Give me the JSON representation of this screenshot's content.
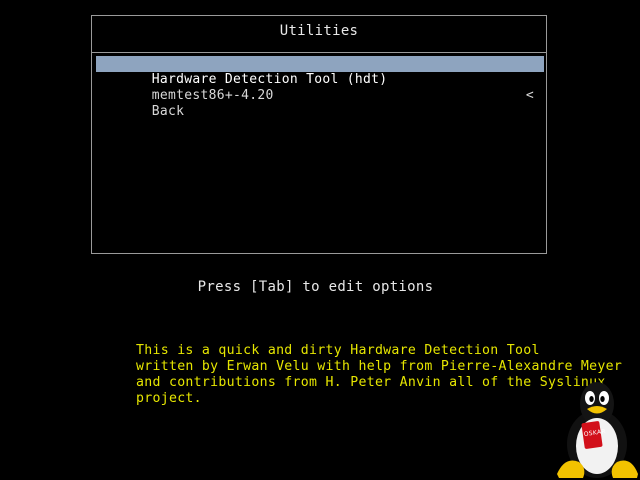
{
  "menu": {
    "title": "Utilities",
    "items": [
      {
        "label": "Hardware Detection Tool (hdt)",
        "selected": true,
        "submenu_indicator": ""
      },
      {
        "label": "memtest86+-4.20",
        "selected": false,
        "submenu_indicator": ""
      },
      {
        "label": "Back",
        "selected": false,
        "submenu_indicator": "<"
      }
    ]
  },
  "hint": "Press [Tab] to edit options",
  "help_text": [
    "This is a quick and dirty Hardware Detection Tool",
    "written by Erwan Velu with help from Pierre-Alexandre Meyer",
    "and contributions from H. Peter Anvin all of the Syslinux",
    "project."
  ],
  "logo": {
    "name": "tux-penguin-icon",
    "badge_text": "OSKAR"
  },
  "colors": {
    "background": "#000000",
    "selection_bar": "#8ea4bf",
    "help_text": "#e6e600",
    "border": "#9a9a9a"
  }
}
